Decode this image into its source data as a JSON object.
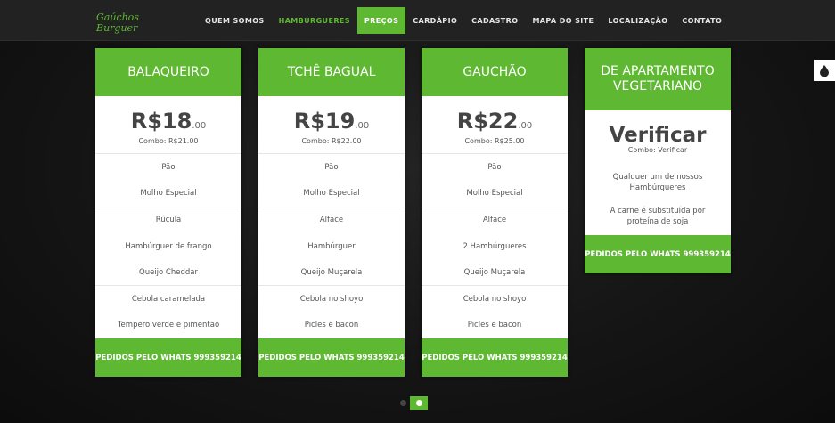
{
  "brand": {
    "line1": "Gaúchos",
    "line2": "Burguer"
  },
  "nav": [
    {
      "label": "QUEM SOMOS",
      "state": "normal"
    },
    {
      "label": "HAMBÚRGUERES",
      "state": "green"
    },
    {
      "label": "PREÇOS",
      "state": "active"
    },
    {
      "label": "CARDÁPIO",
      "state": "normal"
    },
    {
      "label": "CADASTRO",
      "state": "normal"
    },
    {
      "label": "MAPA DO SITE",
      "state": "normal"
    },
    {
      "label": "LOCALIZAÇÃO",
      "state": "normal"
    },
    {
      "label": "CONTATO",
      "state": "normal"
    }
  ],
  "cards": [
    {
      "title": "BALAQUEIRO",
      "price": "R$18",
      "cents": ".00",
      "combo": "Combo: R$21.00",
      "features": [
        "Pão",
        "Molho Especial",
        "Rúcula",
        "Hambúrguer de frango",
        "Queijo Cheddar",
        "Cebola caramelada",
        "Tempero verde e pimentão"
      ],
      "footer": "PEDIDOS PELO WHATS 999359214"
    },
    {
      "title": "TCHÊ BAGUAL",
      "price": "R$19",
      "cents": ".00",
      "combo": "Combo: R$22.00",
      "features": [
        "Pão",
        "Molho Especial",
        "Alface",
        "Hambúrguer",
        "Queijo Muçarela",
        "Cebola no shoyo",
        "Picles e bacon"
      ],
      "footer": "PEDIDOS PELO WHATS 999359214"
    },
    {
      "title": "GAUCHÃO",
      "price": "R$22",
      "cents": ".00",
      "combo": "Combo: R$25.00",
      "features": [
        "Pão",
        "Molho Especial",
        "Alface",
        "2 Hambúrgueres",
        "Queijo Muçarela",
        "Cebola no shoyo",
        "Picles e bacon"
      ],
      "footer": "PEDIDOS PELO WHATS 999359214"
    }
  ],
  "veg_card": {
    "title": "DE APARTAMENTO VEGETARIANO",
    "price": "Verificar",
    "combo": "Combo: Verificar",
    "features": [
      "Qualquer um de nossos Hambúrgueres",
      "A carne é substituída por proteína de soja"
    ],
    "footer": "PEDIDOS PELO WHATS 999359214"
  },
  "side_button": {
    "icon": "water-drop-icon"
  },
  "colors": {
    "accent": "#5fb832",
    "nav_bg": "#222222"
  }
}
